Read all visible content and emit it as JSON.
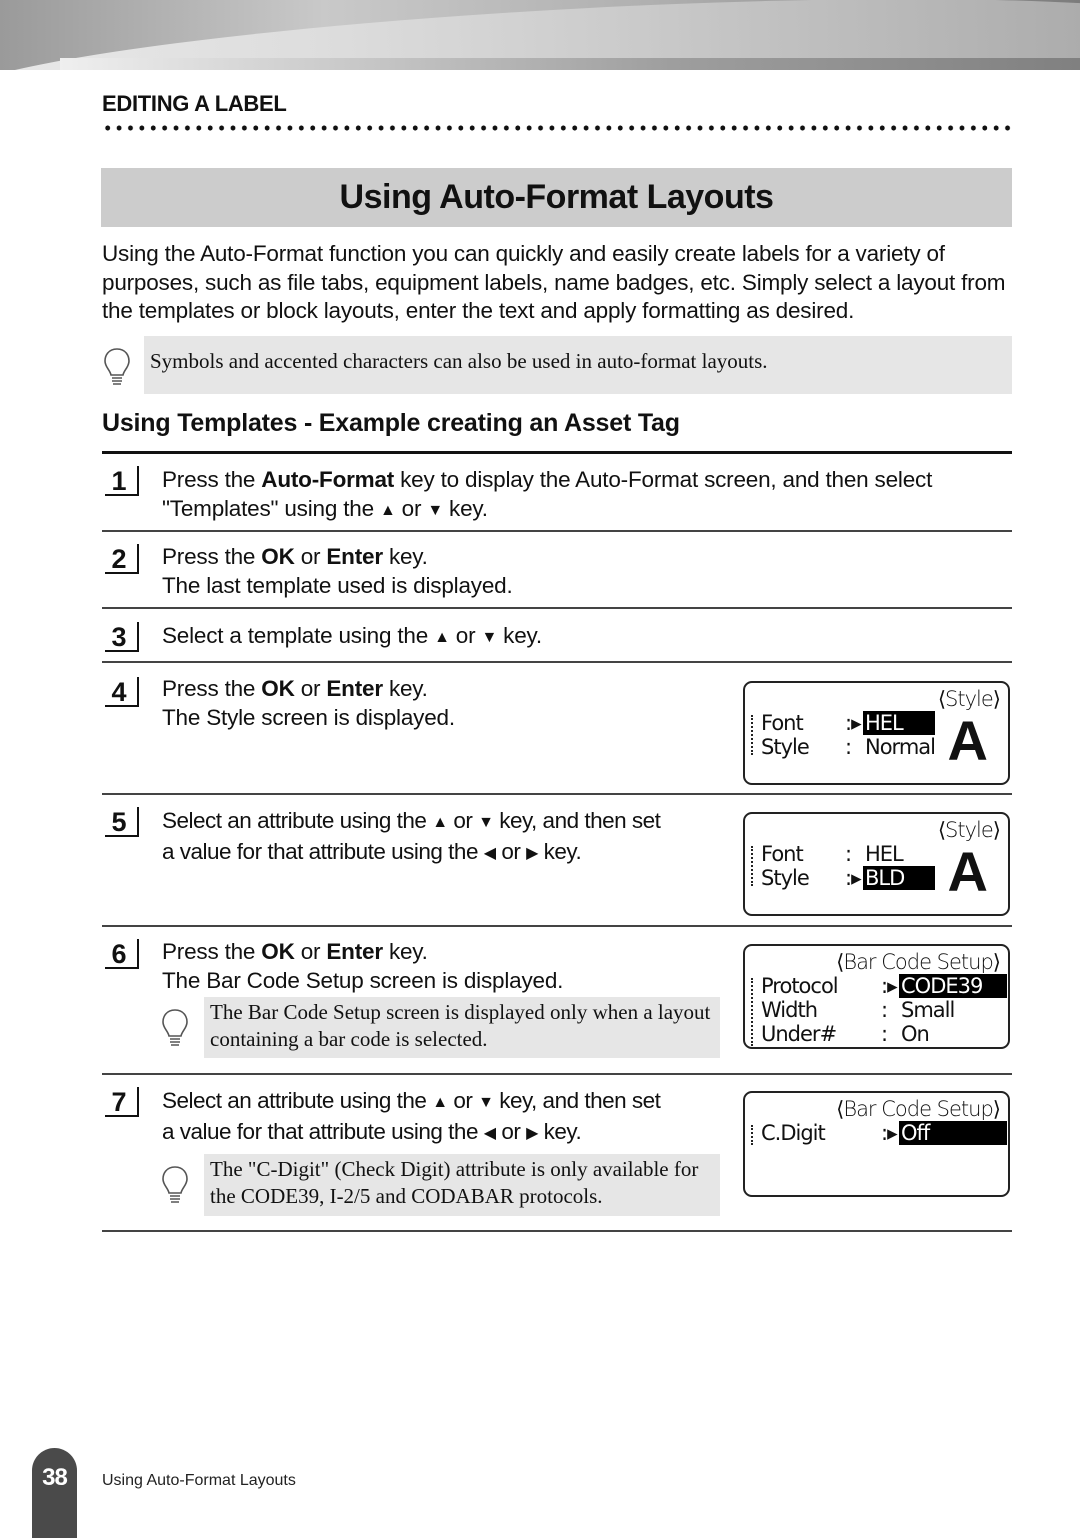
{
  "header": {
    "section_label": "EDITING A LABEL",
    "page_title": "Using Auto-Format Layouts"
  },
  "intro": "Using the Auto-Format function you can quickly and easily create labels for a variety of purposes, such as file tabs, equipment labels, name badges, etc. Simply select a layout from the templates or block layouts, enter the text and apply formatting as desired.",
  "note_top": "Symbols and accented characters can also be used in auto-format layouts.",
  "subheading": "Using Templates - Example creating an Asset Tag",
  "steps": [
    {
      "num": "1",
      "parts": [
        "Press the ",
        "Auto-Format",
        " key to display the Auto-Format screen, and then select",
        "\"Templates\" using the",
        "▲",
        "or",
        "▼",
        "key."
      ]
    },
    {
      "num": "2",
      "line1_a": "Press the ",
      "line1_b": "OK",
      "line1_c": " or ",
      "line1_d": "Enter",
      "line1_e": " key.",
      "line2": "The last template used is displayed."
    },
    {
      "num": "3",
      "text_a": "Select a template using the",
      "up": "▲",
      "or": "or",
      "down": "▼",
      "key": "key."
    },
    {
      "num": "4",
      "line1_a": "Press the ",
      "line1_b": "OK",
      "line1_c": " or ",
      "line1_d": "Enter",
      "line1_e": " key.",
      "line2": "The Style screen is displayed."
    },
    {
      "num": "5",
      "line1_a": "Select an attribute using the",
      "up": "▲",
      "or": "or",
      "down": "▼",
      "line1_b": "key, and then set",
      "line2_a": "a value for that attribute using the",
      "left": "◀",
      "right": "▶",
      "line2_b": "key."
    },
    {
      "num": "6",
      "line1_a": "Press the ",
      "line1_b": "OK",
      "line1_c": " or ",
      "line1_d": "Enter",
      "line1_e": " key.",
      "line2": "The Bar Code Setup screen is displayed.",
      "note": "The Bar Code Setup screen is displayed only when a layout containing a bar code is selected."
    },
    {
      "num": "7",
      "line1_a": "Select an attribute using the",
      "up": "▲",
      "or": "or",
      "down": "▼",
      "line1_b": "key, and then set",
      "line2_a": "a value for that attribute using the",
      "left": "◀",
      "right": "▶",
      "line2_b": "key.",
      "note": "The \"C-Digit\" (Check Digit) attribute is only available for the CODE39, I-2/5 and CODABAR protocols."
    }
  ],
  "screens": {
    "style1": {
      "header": "⟨Style⟩",
      "rows": [
        {
          "label": "Font",
          "sep": ":▸",
          "value": "HEL",
          "selected": true
        },
        {
          "label": "Style",
          "sep": ":",
          "value": "Normal",
          "selected": false
        }
      ],
      "preview": "A"
    },
    "style2": {
      "header": "⟨Style⟩",
      "rows": [
        {
          "label": "Font",
          "sep": ":",
          "value": "HEL",
          "selected": false
        },
        {
          "label": "Style",
          "sep": ":▸",
          "value": "BLD",
          "selected": true
        }
      ],
      "preview": "A"
    },
    "barcode1": {
      "header": "⟨Bar Code Setup⟩",
      "rows": [
        {
          "label": "Protocol",
          "sep": ":▸",
          "value": "CODE39",
          "selected": true
        },
        {
          "label": "Width",
          "sep": ":",
          "value": "Small",
          "selected": false
        },
        {
          "label": "Under#",
          "sep": ":",
          "value": "On",
          "selected": false
        }
      ]
    },
    "barcode2": {
      "header": "⟨Bar Code Setup⟩",
      "rows": [
        {
          "label": "C.Digit",
          "sep": ":▸",
          "value": "Off",
          "selected": true
        }
      ]
    }
  },
  "footer": {
    "page_number": "38",
    "title": "Using Auto-Format Layouts"
  }
}
